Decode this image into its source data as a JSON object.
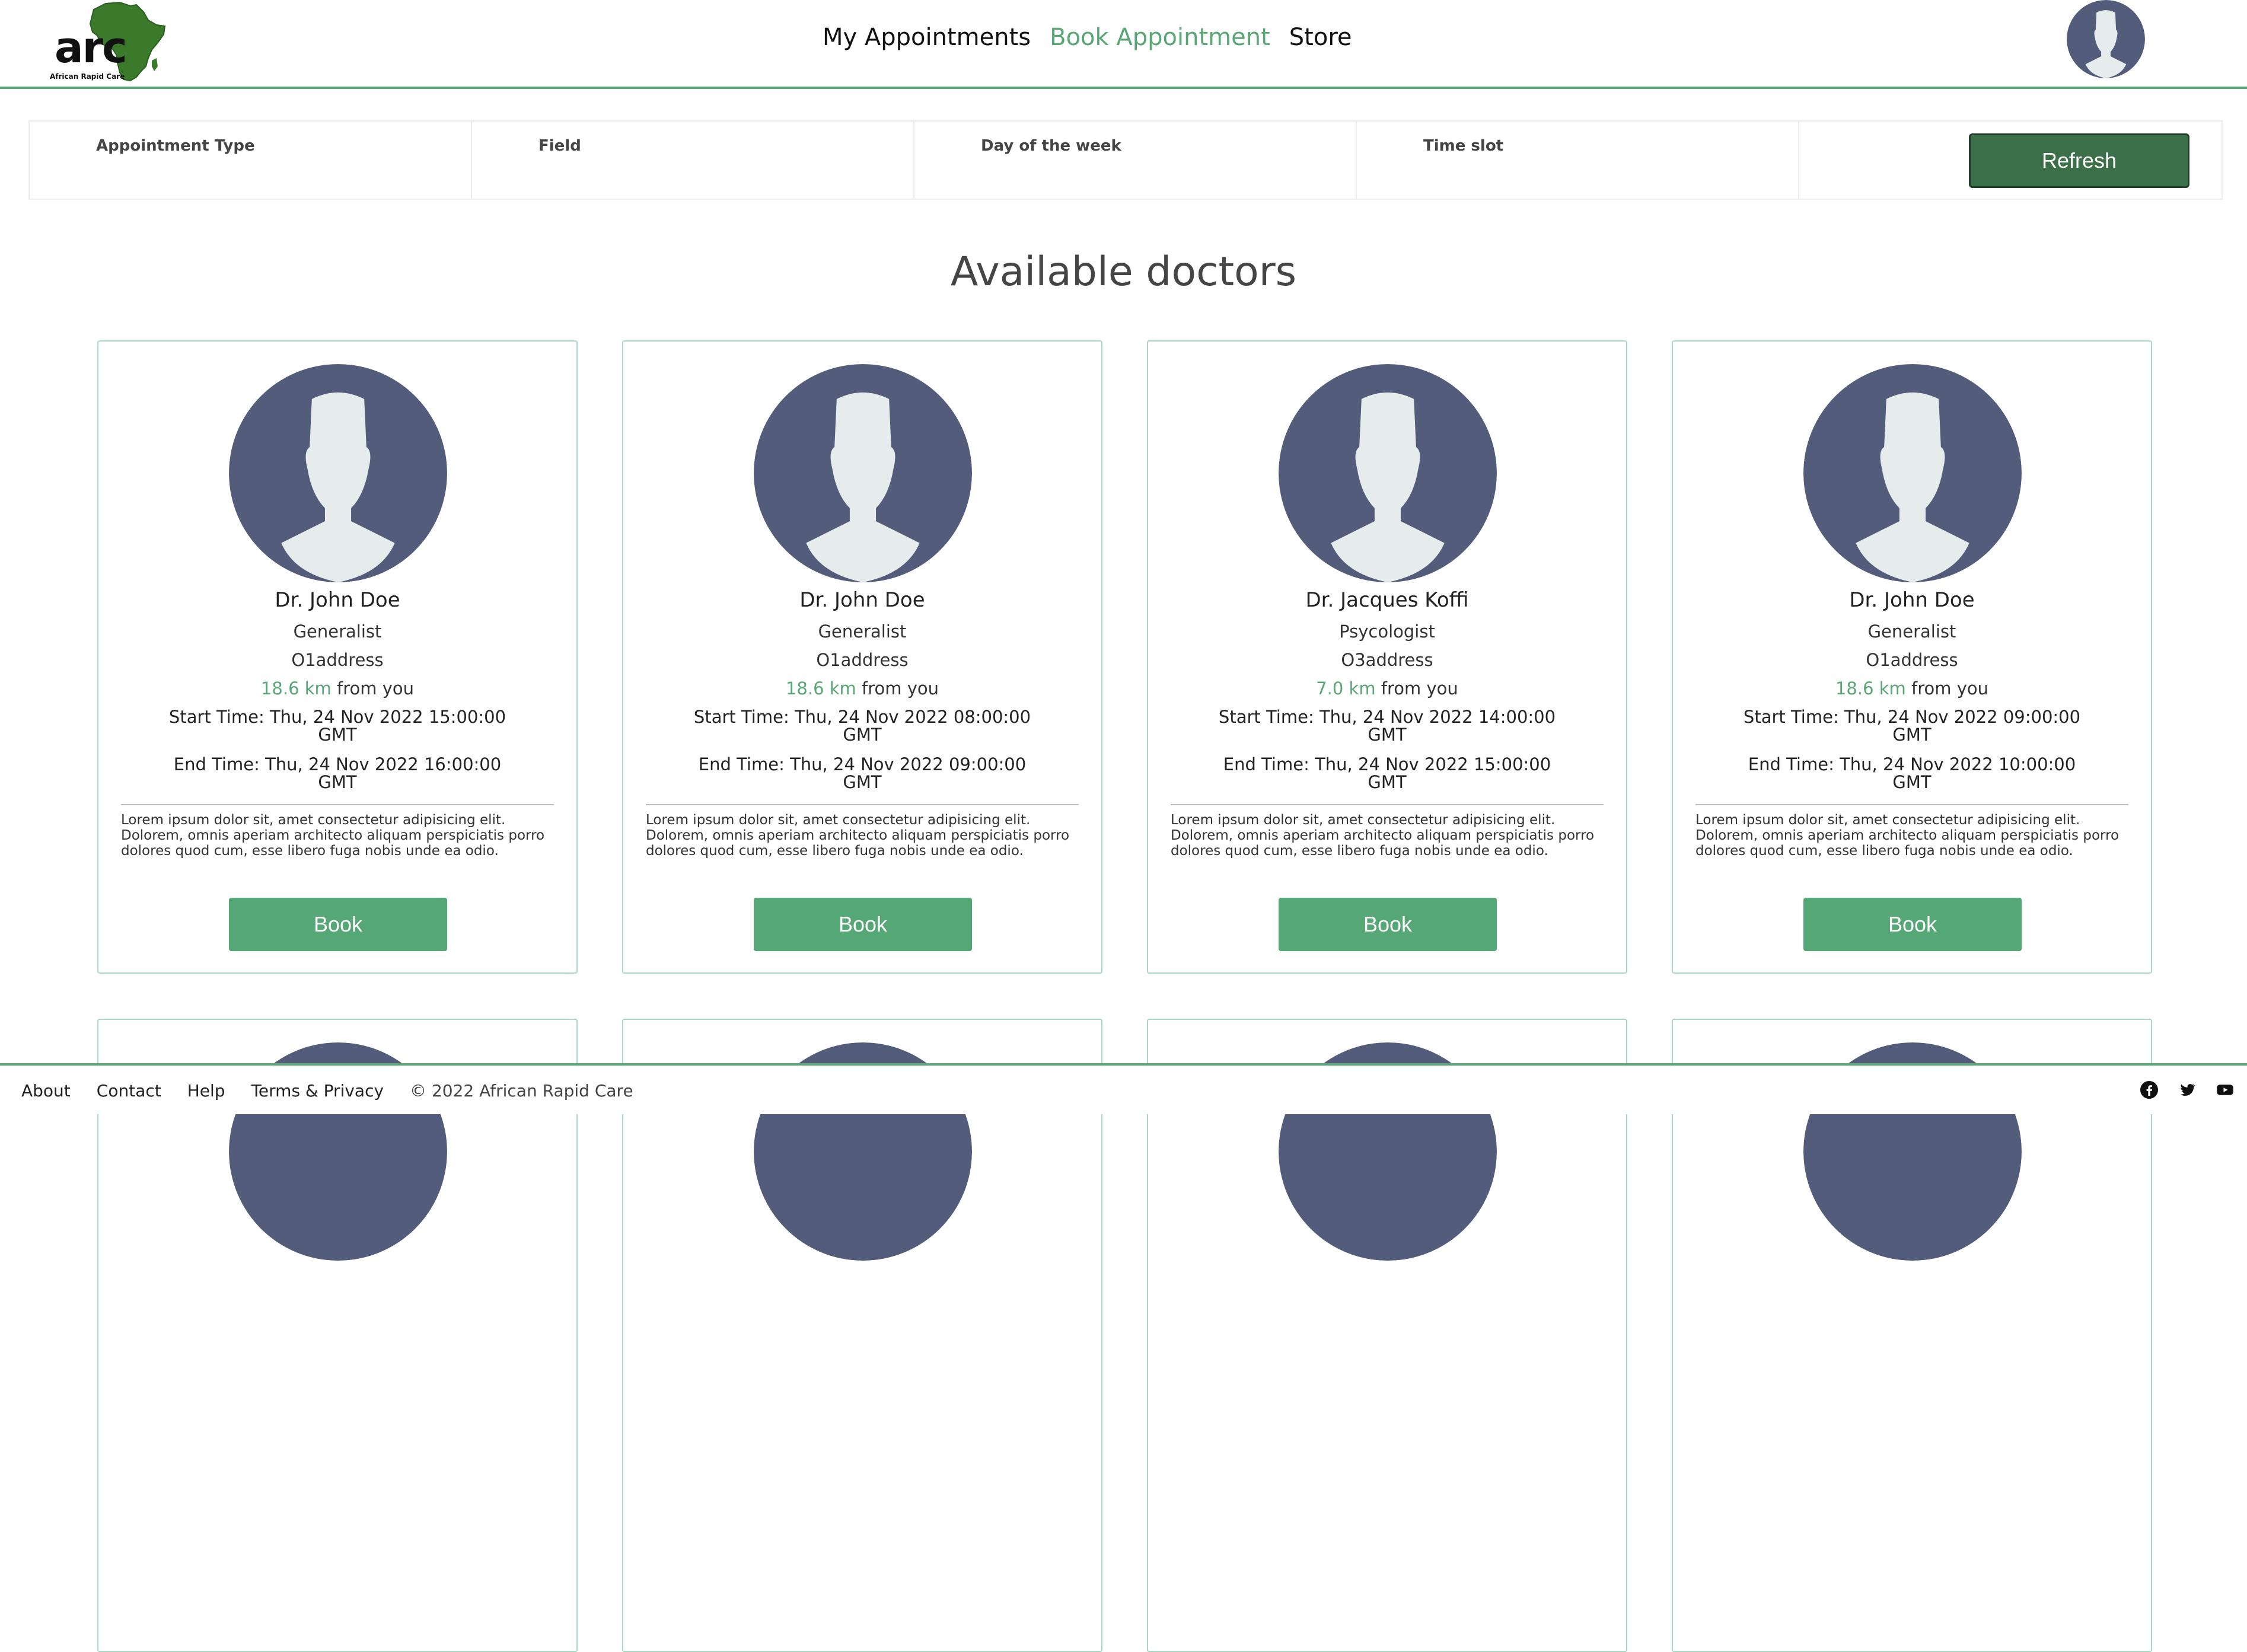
{
  "header": {
    "logo_text": "arc",
    "logo_subtitle": "African Rapid Care",
    "nav": [
      {
        "label": "My Appointments",
        "active": false
      },
      {
        "label": "Book Appointment",
        "active": true
      },
      {
        "label": "Store",
        "active": false
      }
    ],
    "accent_color": "#5aa776"
  },
  "filters": {
    "labels": [
      "Appointment Type",
      "Field",
      "Day of the week",
      "Time slot"
    ],
    "refresh_label": "Refresh"
  },
  "main": {
    "title": "Available doctors"
  },
  "doctors": [
    {
      "name": "Dr. John Doe",
      "field": "Generalist",
      "address": "O1address",
      "distance": "18.6 km",
      "distance_suffix": "from you",
      "start_label": "Start Time:",
      "start_time": "Thu, 24 Nov 2022 15:00:00 GMT",
      "end_label": "End Time:",
      "end_time": "Thu, 24 Nov 2022 16:00:00 GMT",
      "description": "Lorem ipsum dolor sit, amet consectetur adipisicing elit. Dolorem, omnis aperiam architecto aliquam perspiciatis porro dolores quod cum, esse libero fuga nobis unde ea odio.",
      "book_label": "Book"
    },
    {
      "name": "Dr. John Doe",
      "field": "Generalist",
      "address": "O1address",
      "distance": "18.6 km",
      "distance_suffix": "from you",
      "start_label": "Start Time:",
      "start_time": "Thu, 24 Nov 2022 08:00:00 GMT",
      "end_label": "End Time:",
      "end_time": "Thu, 24 Nov 2022 09:00:00 GMT",
      "description": "Lorem ipsum dolor sit, amet consectetur adipisicing elit. Dolorem, omnis aperiam architecto aliquam perspiciatis porro dolores quod cum, esse libero fuga nobis unde ea odio.",
      "book_label": "Book"
    },
    {
      "name": "Dr. Jacques Koffi",
      "field": "Psycologist",
      "address": "O3address",
      "distance": "7.0 km",
      "distance_suffix": "from you",
      "start_label": "Start Time:",
      "start_time": "Thu, 24 Nov 2022 14:00:00 GMT",
      "end_label": "End Time:",
      "end_time": "Thu, 24 Nov 2022 15:00:00 GMT",
      "description": "Lorem ipsum dolor sit, amet consectetur adipisicing elit. Dolorem, omnis aperiam architecto aliquam perspiciatis porro dolores quod cum, esse libero fuga nobis unde ea odio.",
      "book_label": "Book"
    },
    {
      "name": "Dr. John Doe",
      "field": "Generalist",
      "address": "O1address",
      "distance": "18.6 km",
      "distance_suffix": "from you",
      "start_label": "Start Time:",
      "start_time": "Thu, 24 Nov 2022 09:00:00 GMT",
      "end_label": "End Time:",
      "end_time": "Thu, 24 Nov 2022 10:00:00 GMT",
      "description": "Lorem ipsum dolor sit, amet consectetur adipisicing elit. Dolorem, omnis aperiam architecto aliquam perspiciatis porro dolores quod cum, esse libero fuga nobis unde ea odio.",
      "book_label": "Book"
    }
  ],
  "footer": {
    "links": [
      "About",
      "Contact",
      "Help",
      "Terms & Privacy"
    ],
    "copyright": "© 2022 African Rapid Care",
    "social_icons": [
      "facebook-icon",
      "twitter-icon",
      "youtube-icon"
    ]
  }
}
